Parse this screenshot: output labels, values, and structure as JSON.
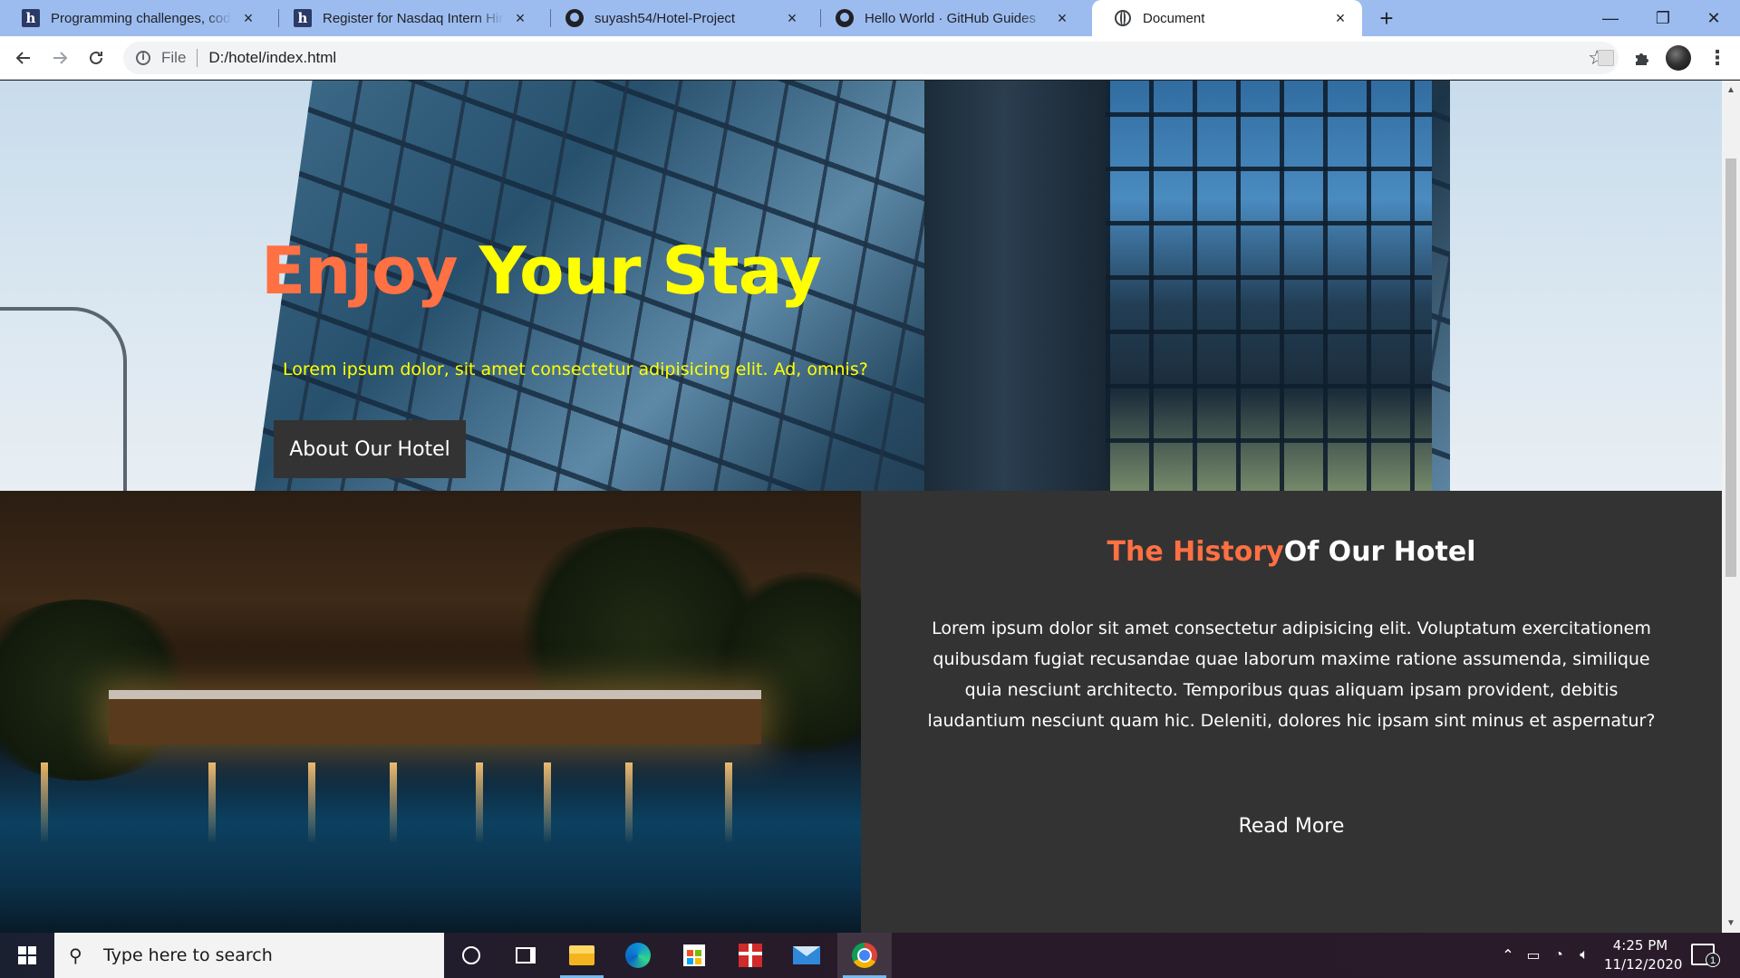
{
  "browser": {
    "tabs": [
      {
        "title": "Programming challenges, coding",
        "icon": "hackerearth-icon",
        "active": false
      },
      {
        "title": "Register for Nasdaq Intern Hiring",
        "icon": "hackerearth-icon",
        "active": false
      },
      {
        "title": "suyash54/Hotel-Project",
        "icon": "github-icon",
        "active": false
      },
      {
        "title": "Hello World · GitHub Guides",
        "icon": "github-icon",
        "active": false
      },
      {
        "title": "Document",
        "icon": "globe-icon",
        "active": true
      }
    ],
    "tab_close_glyph": "×",
    "new_tab_glyph": "+",
    "address": {
      "scheme_label": "File",
      "url": "D:/hotel/index.html"
    },
    "window_controls": {
      "minimize": "—",
      "restore": "❐",
      "close": "✕"
    },
    "tab_icon_letter": "h"
  },
  "hero": {
    "title_word1": "Enjoy",
    "title_word2": "Your Stay",
    "subtitle": "Lorem ipsum dolor, sit amet consectetur adipisicing elit. Ad, omnis?",
    "button_label": "About Our Hotel",
    "colors": {
      "accent": "#ff7043",
      "highlight": "#ffff00"
    }
  },
  "history": {
    "title_part1": "The History",
    "title_part2": "Of Our Hotel",
    "body": "Lorem ipsum dolor sit amet consectetur adipisicing elit. Voluptatum exercitationem quibusdam fugiat recusandae quae laborum maxime ratione assumenda, similique quia nesciunt architecto. Temporibus quas aliquam ipsam provident, debitis laudantium nesciunt quam hic. Deleniti, dolores hic ipsam sint minus et aspernatur?",
    "read_more_label": "Read More",
    "background": "#333333"
  },
  "taskbar": {
    "search_placeholder": "Type here to search",
    "apps": [
      "cortana-icon",
      "task-view-icon",
      "file-explorer-icon",
      "edge-icon",
      "store-icon",
      "gift-app-icon",
      "mail-icon",
      "chrome-icon"
    ],
    "clock": {
      "time": "4:25 PM",
      "date": "11/12/2020"
    },
    "notification_count": "1"
  }
}
